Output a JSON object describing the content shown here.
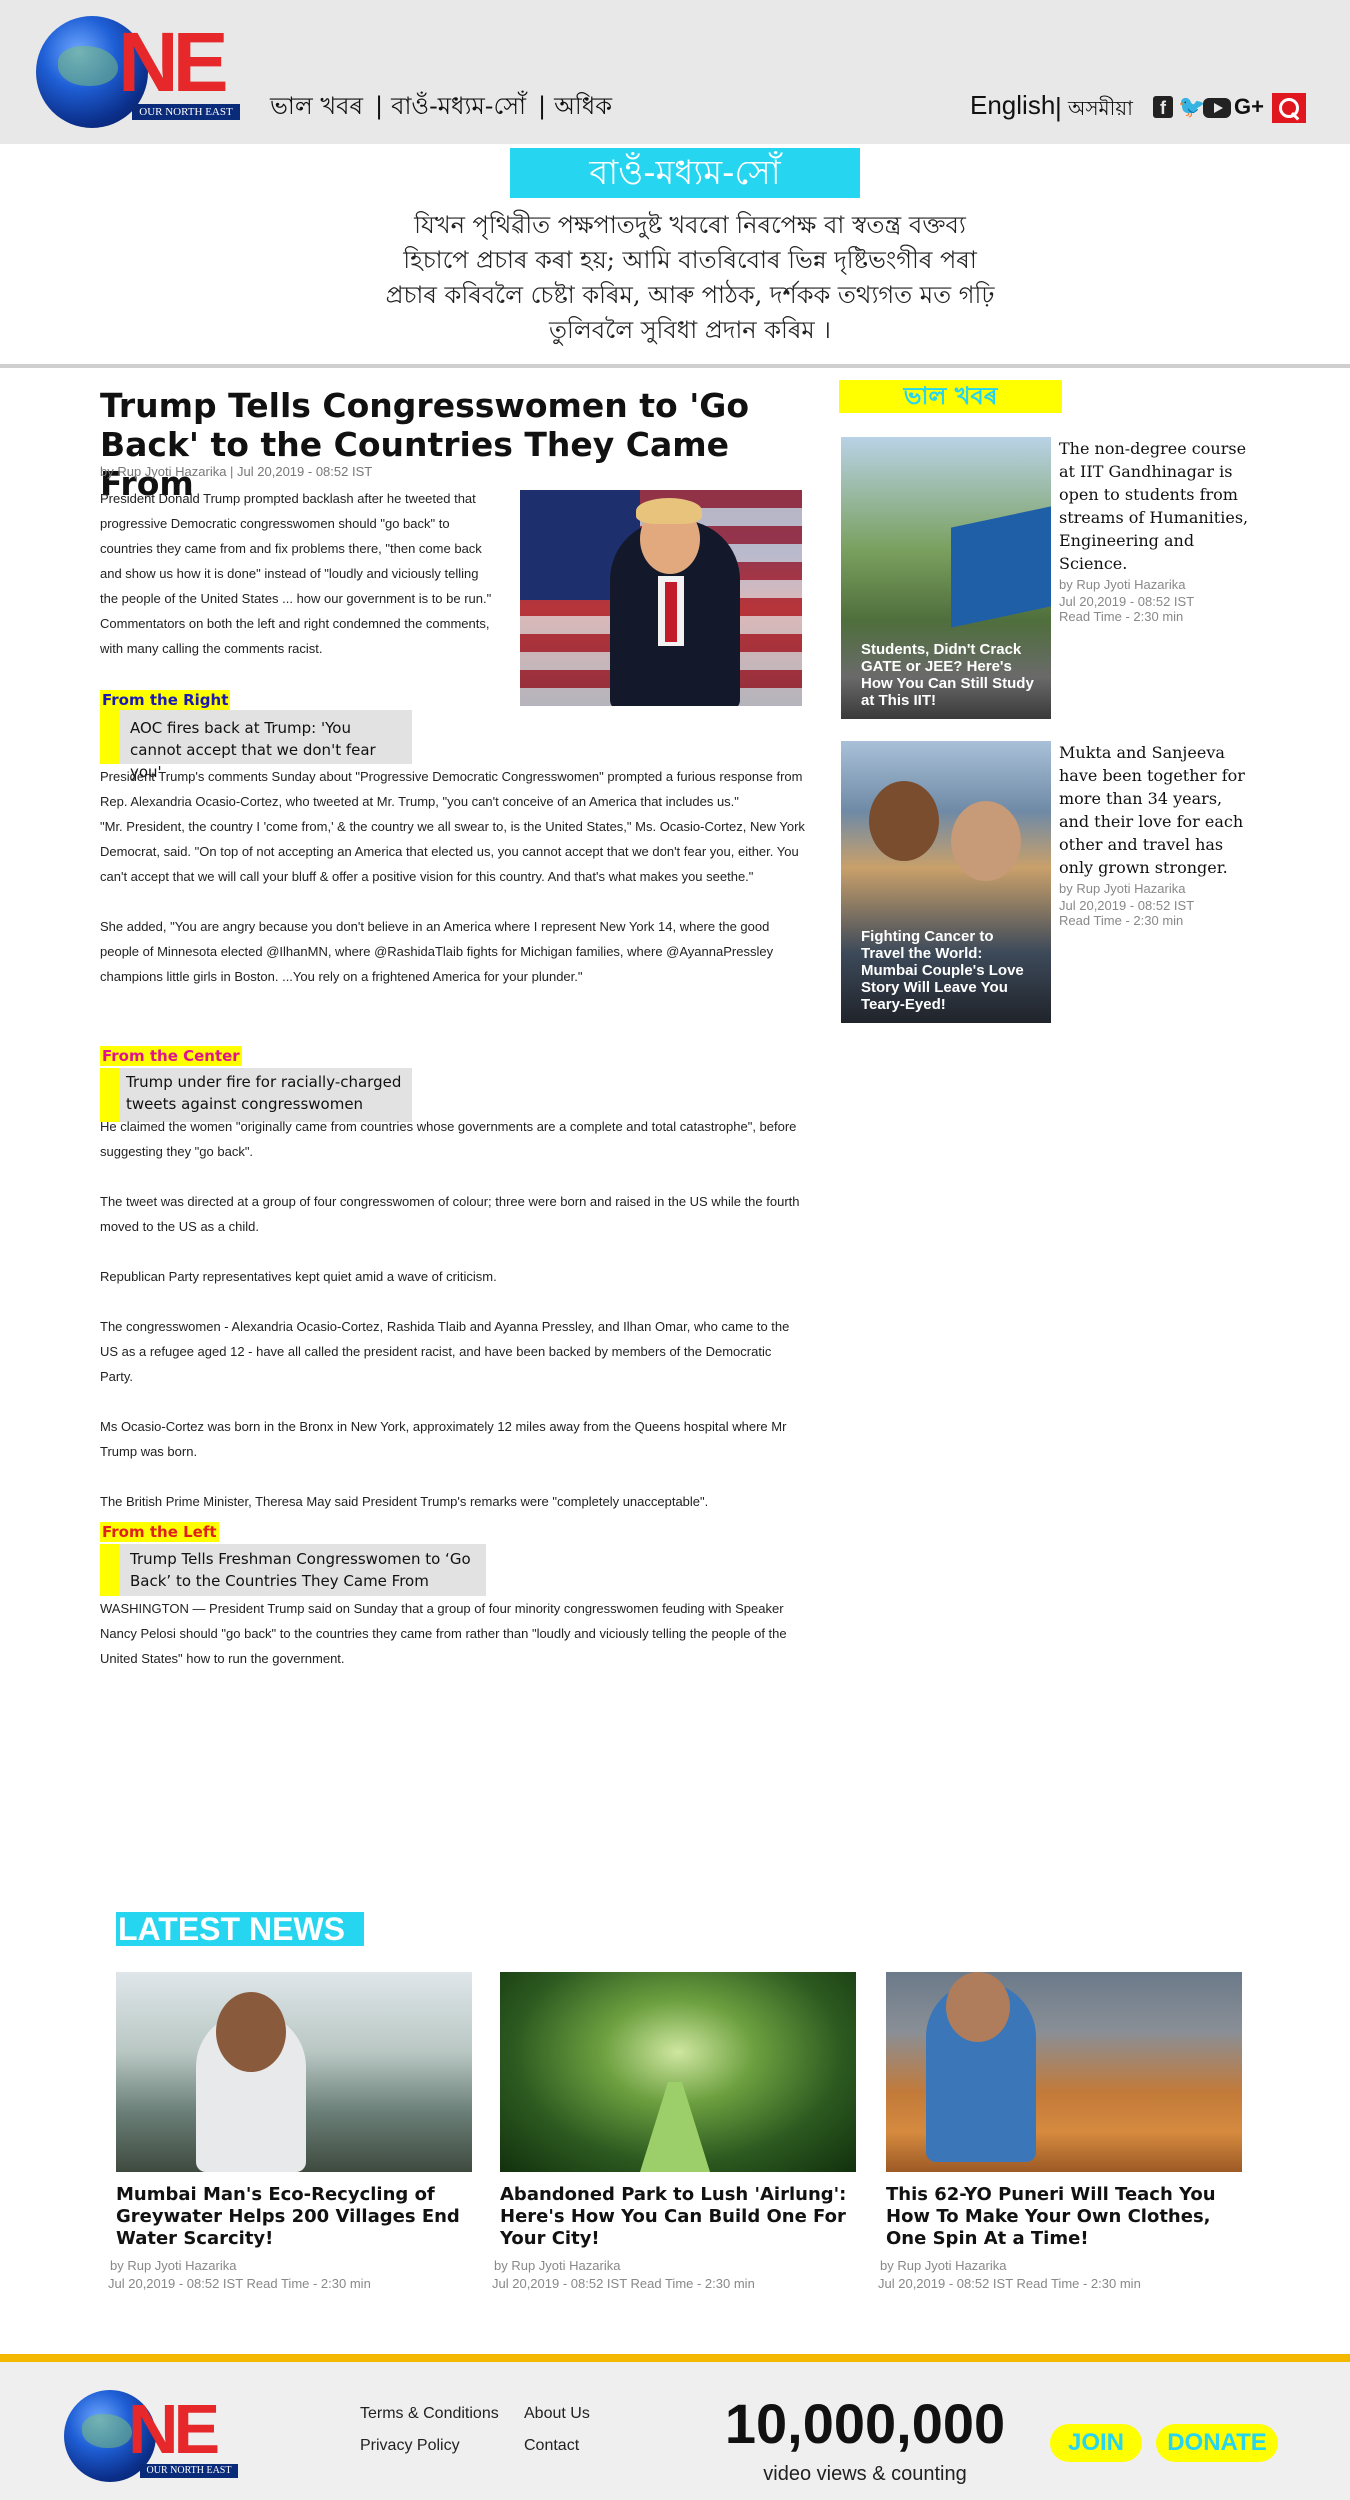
{
  "brand": {
    "logo_text": "NE",
    "logo_tagline": "OUR NORTH EAST"
  },
  "nav": {
    "items": [
      "ভাল খবৰ",
      "বাওঁ-মধ্যম-সোঁ",
      "অধিক"
    ],
    "separators": [
      "|",
      "|"
    ]
  },
  "header_right": {
    "lang_en": "English",
    "lang_sep": "|",
    "lang_as": "অসমীয়া",
    "icons": [
      "facebook-icon",
      "twitter-icon",
      "youtube-icon",
      "googleplus-icon",
      "search-icon"
    ],
    "gplus_label": "G+",
    "search_color": "#e0171f"
  },
  "intro": {
    "title": "বাওঁ-মধ্যম-সোঁ",
    "text": "যিখন পৃথিৱীত পক্ষপাতদুষ্ট খবৰো নিৰপেক্ষ বা স্বতন্ত্ৰ বক্তব্য হিচাপে প্ৰচাৰ কৰা হয়; আমি বাতৰিবোৰ ভিন্ন দৃষ্টিভংগীৰ পৰা প্ৰচাৰ কৰিবলৈ চেষ্টা কৰিম, আৰু পাঠক, দৰ্শকক তথ্যগত মত গঢ়ি তুলিবলৈ সুবিধা প্ৰদান কৰিম ।"
  },
  "article": {
    "title": "Trump Tells Congresswomen to 'Go Back' to the Countries They Came From",
    "byline": "by Rup Jyoti Hazarika | Jul 20,2019 - 08:52 IST",
    "lead": "President Donald Trump prompted backlash after he tweeted that progressive Democratic congresswomen should \"go back\" to countries they came from and fix problems there, \"then come back and show us how it is done\" instead of \"loudly and viciously telling the people of the United States ... how our government is to be run.\" Commentators on both the left and right condemned the comments, with many calling the comments racist.",
    "right": {
      "tag": "From the Right",
      "quote": "AOC fires back at Trump: 'You cannot accept that we don't fear you'",
      "paragraphs": [
        "President Trump's comments Sunday about \"Progressive Democratic Congresswomen\" prompted a furious response from Rep. Alexandria Ocasio-Cortez, who tweeted at Mr. Trump, \"you can't conceive of an America that includes us.\"",
        "\"Mr. President, the country I 'come from,' & the country we all swear to, is the United States,\" Ms. Ocasio-Cortez, New York Democrat, said. \"On top of not accepting an America that elected us, you cannot accept that we don't fear you, either. You can't accept that we will call your bluff & offer a positive vision for this country. And that's what makes you seethe.\"",
        "She added, \"You are angry because you don't believe in an America where I represent New York 14, where the good people of Minnesota elected @IlhanMN, where @RashidaTlaib fights for Michigan families, where @AyannaPressley champions little girls in Boston. ...You rely on a frightened America for your plunder.\""
      ]
    },
    "center": {
      "tag": "From the Center",
      "quote": "Trump under fire for racially-charged tweets against congresswomen",
      "paragraphs": [
        "He claimed the women \"originally came from countries whose governments are a complete and total catastrophe\", before suggesting they \"go back\".",
        "The tweet was directed at a group of four congresswomen of colour; three were born and raised in the US while the fourth moved to the US as a child.",
        "Republican Party representatives kept quiet amid a wave of criticism.",
        "The congresswomen - Alexandria Ocasio-Cortez, Rashida Tlaib and Ayanna Pressley, and Ilhan Omar, who came to the US as a refugee aged 12 - have all called the president racist, and have been backed by members of the Democratic Party.",
        "Ms Ocasio-Cortez was born in the Bronx in New York, approximately 12 miles away from the Queens hospital where Mr Trump was born.",
        "The British Prime Minister, Theresa May said President Trump's remarks were \"completely unacceptable\"."
      ]
    },
    "left": {
      "tag": "From the Left",
      "quote": "Trump Tells Freshman Congresswomen to ‘Go Back’ to the Countries They Came From",
      "paragraphs": [
        "WASHINGTON — President Trump said on Sunday that a group of four minority congresswomen feuding with Speaker Nancy Pelosi should \"go back\" to the countries they came from rather than \"loudly and viciously telling the people of the United States\" how to run the government."
      ]
    }
  },
  "sidebar": {
    "title": "ভাল খবৰ",
    "cards": [
      {
        "caption": "Students, Didn't Crack GATE or JEE? Here's How You Can Still Study at This IIT!",
        "text": "The non-degree course at IIT Gandhinagar is open to students from streams of Humanities, Engineering and Science.",
        "author": "by Rup Jyoti Hazarika",
        "date": "Jul 20,2019 - 08:52 IST",
        "read_time": "Read Time - 2:30 min"
      },
      {
        "caption": "Fighting Cancer to Travel the World: Mumbai Couple's Love Story Will Leave You Teary-Eyed!",
        "text": "Mukta and Sanjeeva have been together for more than 34 years, and their love for each other and travel has only grown stronger.",
        "author": "by Rup Jyoti Hazarika",
        "date": "Jul 20,2019 - 08:52 IST",
        "read_time": "Read Time - 2:30 min"
      }
    ]
  },
  "latest": {
    "title": "LATEST NEWS",
    "cards": [
      {
        "title": "Mumbai Man's Eco-Recycling of Greywater Helps 200 Villages End Water Scarcity!",
        "author": "by Rup Jyoti Hazarika",
        "meta": "Jul 20,2019 - 08:52 IST Read Time - 2:30 min"
      },
      {
        "title": "Abandoned Park to Lush 'Airlung': Here's How You Can Build One For Your City!",
        "author": "by Rup Jyoti Hazarika",
        "meta": "Jul 20,2019 - 08:52 IST Read Time - 2:30 min"
      },
      {
        "title": "This 62-YO Puneri Will Teach You How To Make Your Own Clothes, One Spin At a Time!",
        "author": "by Rup Jyoti Hazarika",
        "meta": "Jul 20,2019 - 08:52 IST Read Time - 2:30 min"
      }
    ]
  },
  "footer": {
    "links": [
      "Terms & Conditions",
      "About Us",
      "Privacy Policy",
      "Contact"
    ],
    "counter": "10,000,000",
    "counter_label": "video views & counting",
    "join": "JOIN",
    "donate": "DONATE",
    "accent_color": "#f5b800"
  }
}
